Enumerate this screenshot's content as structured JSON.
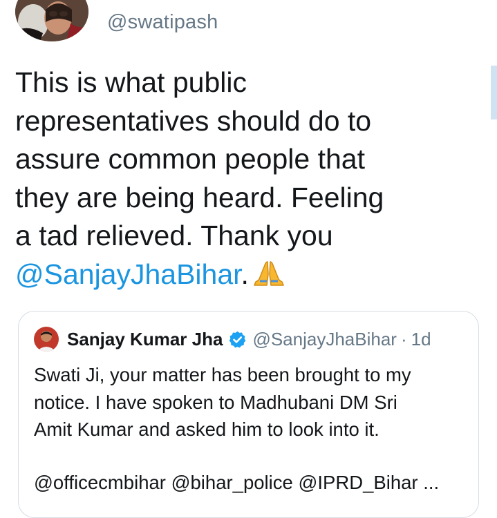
{
  "author": {
    "handle": "@swatipash",
    "avatar": "profile-photo"
  },
  "tweet": {
    "line1": "This is what public",
    "line2": "representatives should do to",
    "line3": "assure common people that",
    "line4": "they are being heard. Feeling",
    "line5": "a tad relieved. Thank you",
    "mention": "@SanjayJhaBihar",
    "after_mention": ".",
    "emoji_icon": "folded-hands-icon"
  },
  "quoted_tweet": {
    "name": "Sanjay Kumar Jha",
    "verified_icon": "verified-badge-icon",
    "handle": "@SanjayJhaBihar",
    "separator": "·",
    "time": "1d",
    "body": {
      "line1": "Swati Ji, your matter has been brought to my",
      "line2": "notice. I have spoken to Madhubani DM Sri",
      "line3": "Amit Kumar and asked him to look into it."
    },
    "mentions": "@officecmbihar @bihar_police @IPRD_Bihar ..."
  },
  "colors": {
    "link": "#1b95e0",
    "secondary_text": "#657786",
    "primary_text": "#14171a",
    "card_border": "#d6dde3",
    "verified": "#1da1f2"
  }
}
